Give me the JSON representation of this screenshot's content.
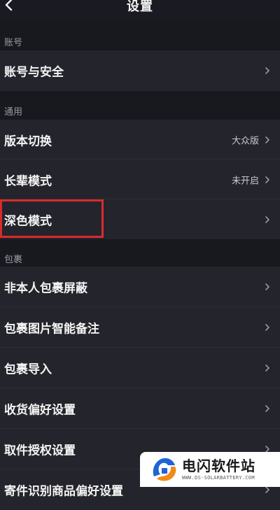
{
  "header": {
    "title": "设置",
    "back_icon": "chevron-left-icon"
  },
  "sections": {
    "account": {
      "label": "账号",
      "items": [
        {
          "label": "账号与安全",
          "value": ""
        }
      ]
    },
    "general": {
      "label": "通用",
      "items": [
        {
          "label": "版本切换",
          "value": "大众版"
        },
        {
          "label": "长辈模式",
          "value": "未开启"
        },
        {
          "label": "深色模式",
          "value": ""
        }
      ]
    },
    "package": {
      "label": "包裹",
      "items": [
        {
          "label": "非本人包裹屏蔽",
          "value": ""
        },
        {
          "label": "包裹图片智能备注",
          "value": ""
        },
        {
          "label": "包裹导入",
          "value": ""
        },
        {
          "label": "收货偏好设置",
          "value": ""
        },
        {
          "label": "取件授权设置",
          "value": ""
        },
        {
          "label": "寄件识别商品偏好设置",
          "value": ""
        }
      ]
    }
  },
  "watermark": {
    "title": "电闪软件站",
    "subtitle": "WWW.DS-SOLARBATTERY.COM"
  },
  "colors": {
    "background": "#18181f",
    "row_background": "#24242c",
    "highlight_border": "#d92b2b",
    "watermark_blue": "#1f64d6",
    "watermark_orange": "#f08a1c"
  }
}
